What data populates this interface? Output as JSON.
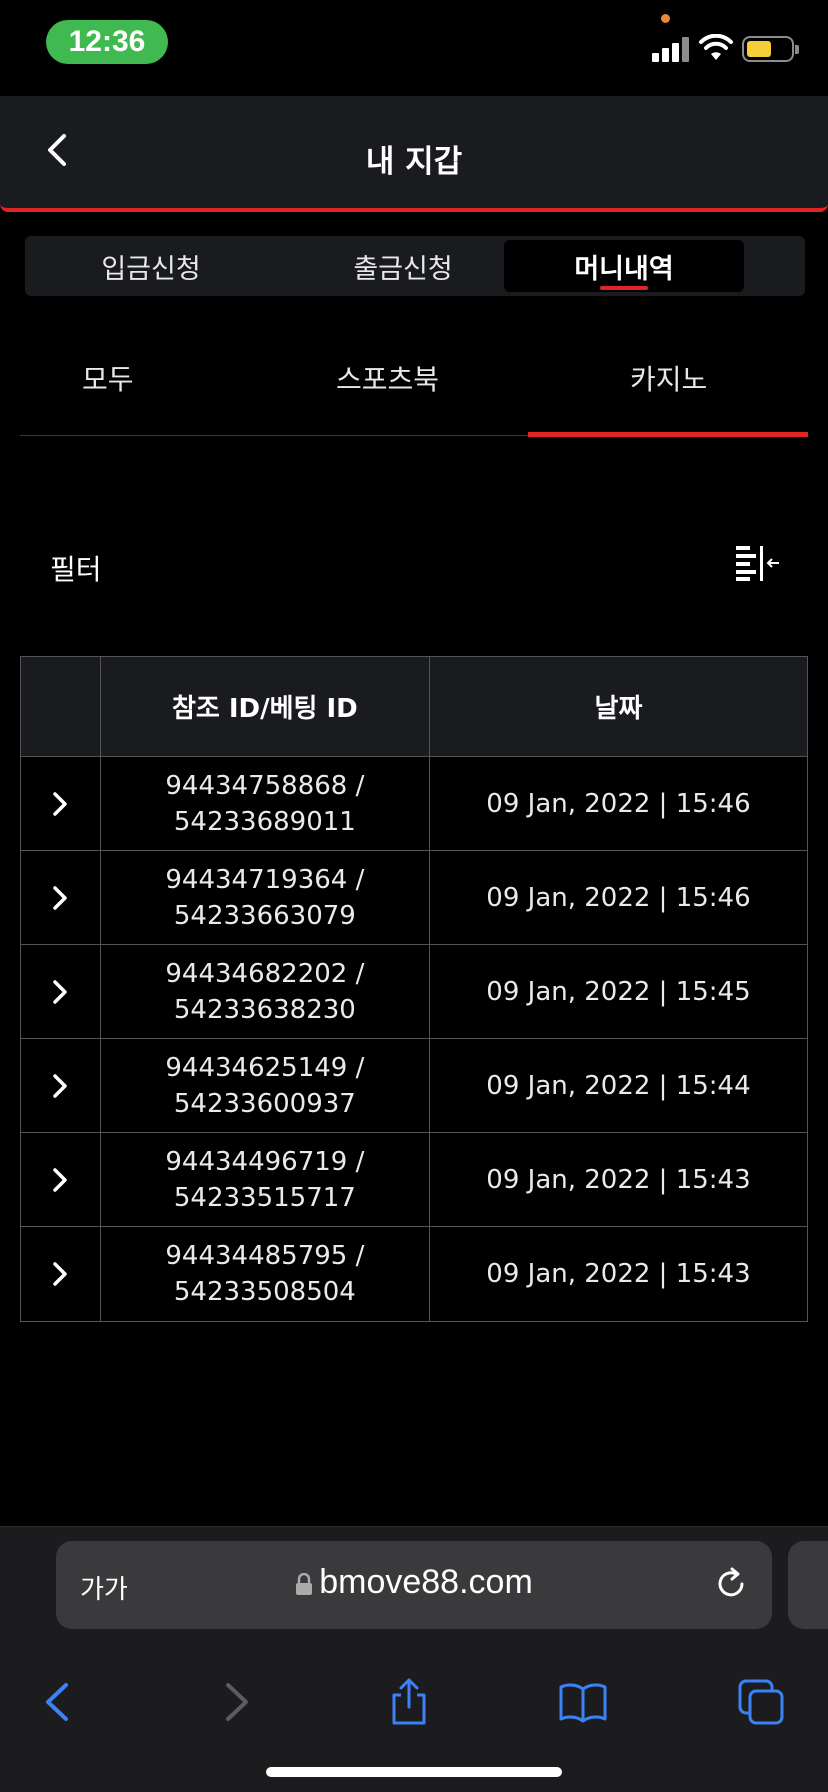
{
  "status": {
    "time": "12:36"
  },
  "header": {
    "title": "내 지갑"
  },
  "tabs": [
    {
      "label": "입금신청"
    },
    {
      "label": "출금신청"
    },
    {
      "label": "머니내역"
    }
  ],
  "subtabs": [
    {
      "label": "모두"
    },
    {
      "label": "스포츠북"
    },
    {
      "label": "카지노"
    }
  ],
  "filter": {
    "label": "필터"
  },
  "table": {
    "headers": [
      "",
      "참조 ID/베팅 ID",
      "날짜"
    ],
    "rows": [
      {
        "ref": "94434758868 /",
        "bet": "54233689011",
        "date": "09 Jan, 2022 | 15:46"
      },
      {
        "ref": "94434719364 /",
        "bet": "54233663079",
        "date": "09 Jan, 2022 | 15:46"
      },
      {
        "ref": "94434682202 /",
        "bet": "54233638230",
        "date": "09 Jan, 2022 | 15:45"
      },
      {
        "ref": "94434625149 /",
        "bet": "54233600937",
        "date": "09 Jan, 2022 | 15:44"
      },
      {
        "ref": "94434496719 /",
        "bet": "54233515717",
        "date": "09 Jan, 2022 | 15:43"
      },
      {
        "ref": "94434485795 /",
        "bet": "54233508504",
        "date": "09 Jan, 2022 | 15:43"
      }
    ]
  },
  "browser": {
    "text_size": "가가",
    "url": "bmove88.com"
  },
  "colors": {
    "accent": "#e02424",
    "panel": "#1a1b1f",
    "ios_blue": "#3b82f6"
  }
}
